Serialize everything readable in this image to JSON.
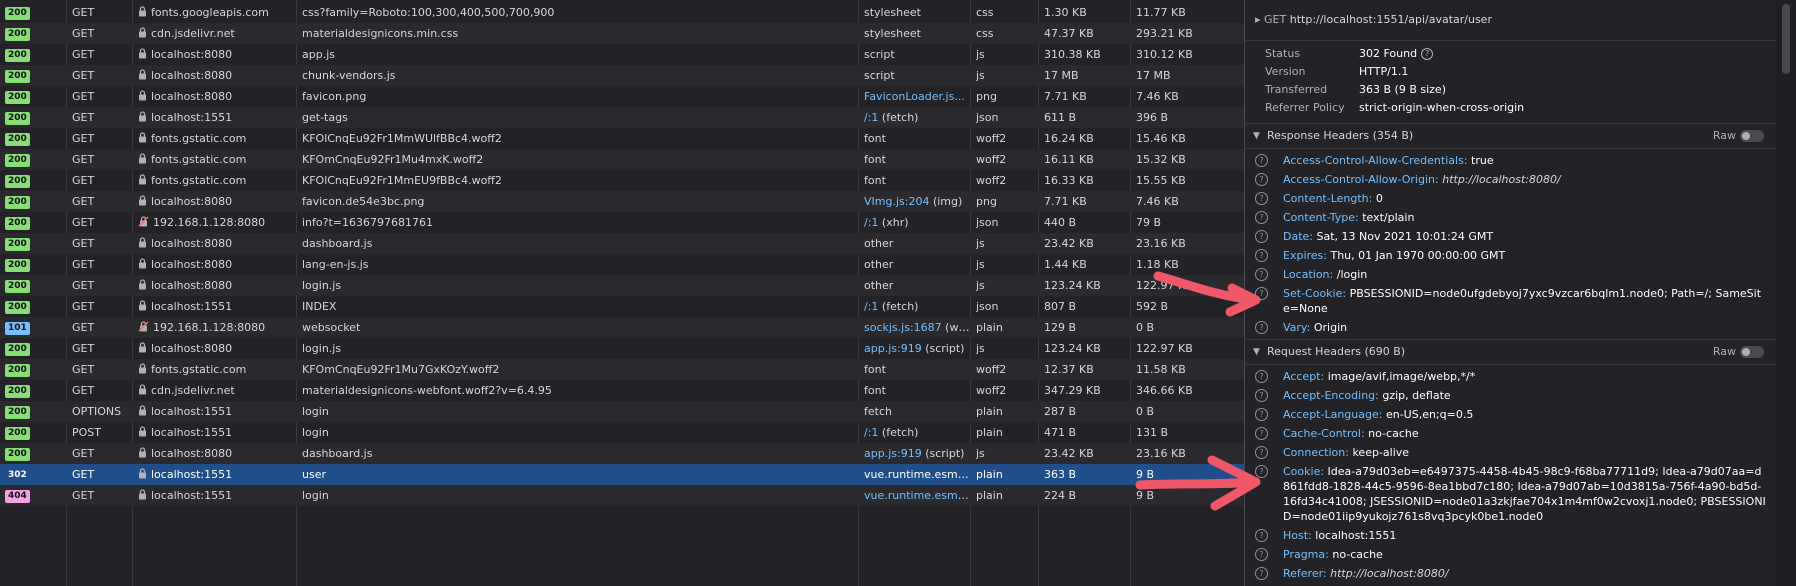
{
  "requests": [
    {
      "status": "200",
      "method": "GET",
      "secure": "lock",
      "domain": "fonts.googleapis.com",
      "file": "css?family=Roboto:100,300,400,500,700,900",
      "initiator": "stylesheet",
      "initiator_extra": "",
      "type": "css",
      "transferred": "1.30 KB",
      "size": "11.77 KB"
    },
    {
      "status": "200",
      "method": "GET",
      "secure": "lock",
      "domain": "cdn.jsdelivr.net",
      "file": "materialdesignicons.min.css",
      "initiator": "stylesheet",
      "initiator_extra": "",
      "type": "css",
      "transferred": "47.37 KB",
      "size": "293.21 KB"
    },
    {
      "status": "200",
      "method": "GET",
      "secure": "lock",
      "domain": "localhost:8080",
      "file": "app.js",
      "initiator": "script",
      "initiator_extra": "",
      "type": "js",
      "transferred": "310.38 KB",
      "size": "310.12 KB"
    },
    {
      "status": "200",
      "method": "GET",
      "secure": "lock",
      "domain": "localhost:8080",
      "file": "chunk-vendors.js",
      "initiator": "script",
      "initiator_extra": "",
      "type": "js",
      "transferred": "17 MB",
      "size": "17 MB"
    },
    {
      "status": "200",
      "method": "GET",
      "secure": "lock",
      "domain": "localhost:8080",
      "file": "favicon.png",
      "initiator": "FaviconLoader.js...",
      "initiator_extra": "",
      "type": "png",
      "transferred": "7.71 KB",
      "size": "7.46 KB",
      "initiator_link": true
    },
    {
      "status": "200",
      "method": "GET",
      "secure": "lock",
      "domain": "localhost:1551",
      "file": "get-tags",
      "initiator": "/:1",
      "initiator_extra": " (fetch)",
      "type": "json",
      "transferred": "611 B",
      "size": "396 B",
      "initiator_link": true
    },
    {
      "status": "200",
      "method": "GET",
      "secure": "lock",
      "domain": "fonts.gstatic.com",
      "file": "KFOlCnqEu92Fr1MmWUlfBBc4.woff2",
      "initiator": "font",
      "initiator_extra": "",
      "type": "woff2",
      "transferred": "16.24 KB",
      "size": "15.46 KB"
    },
    {
      "status": "200",
      "method": "GET",
      "secure": "lock",
      "domain": "fonts.gstatic.com",
      "file": "KFOmCnqEu92Fr1Mu4mxK.woff2",
      "initiator": "font",
      "initiator_extra": "",
      "type": "woff2",
      "transferred": "16.11 KB",
      "size": "15.32 KB"
    },
    {
      "status": "200",
      "method": "GET",
      "secure": "lock",
      "domain": "fonts.gstatic.com",
      "file": "KFOlCnqEu92Fr1MmEU9fBBc4.woff2",
      "initiator": "font",
      "initiator_extra": "",
      "type": "woff2",
      "transferred": "16.33 KB",
      "size": "15.55 KB"
    },
    {
      "status": "200",
      "method": "GET",
      "secure": "lock",
      "domain": "localhost:8080",
      "file": "favicon.de54e3bc.png",
      "initiator": "VImg.js:204",
      "initiator_extra": " (img)",
      "type": "png",
      "transferred": "7.71 KB",
      "size": "7.46 KB",
      "initiator_link": true
    },
    {
      "status": "200",
      "method": "GET",
      "secure": "insecure",
      "domain": "192.168.1.128:8080",
      "file": "info?t=1636797681761",
      "initiator": "/:1",
      "initiator_extra": " (xhr)",
      "type": "json",
      "transferred": "440 B",
      "size": "79 B",
      "initiator_link": true
    },
    {
      "status": "200",
      "method": "GET",
      "secure": "lock",
      "domain": "localhost:8080",
      "file": "dashboard.js",
      "initiator": "other",
      "initiator_extra": "",
      "type": "js",
      "transferred": "23.42 KB",
      "size": "23.16 KB"
    },
    {
      "status": "200",
      "method": "GET",
      "secure": "lock",
      "domain": "localhost:8080",
      "file": "lang-en-js.js",
      "initiator": "other",
      "initiator_extra": "",
      "type": "js",
      "transferred": "1.44 KB",
      "size": "1.18 KB"
    },
    {
      "status": "200",
      "method": "GET",
      "secure": "lock",
      "domain": "localhost:8080",
      "file": "login.js",
      "initiator": "other",
      "initiator_extra": "",
      "type": "js",
      "transferred": "123.24 KB",
      "size": "122.97 KB"
    },
    {
      "status": "200",
      "method": "GET",
      "secure": "lock",
      "domain": "localhost:1551",
      "file": "INDEX",
      "initiator": "/:1",
      "initiator_extra": " (fetch)",
      "type": "json",
      "transferred": "807 B",
      "size": "592 B",
      "initiator_link": true
    },
    {
      "status": "101",
      "method": "GET",
      "secure": "insecure",
      "domain": "192.168.1.128:8080",
      "file": "websocket",
      "initiator": "sockjs.js:1687",
      "initiator_extra": " (we...",
      "type": "plain",
      "transferred": "129 B",
      "size": "0 B",
      "initiator_link": true
    },
    {
      "status": "200",
      "method": "GET",
      "secure": "lock",
      "domain": "localhost:8080",
      "file": "login.js",
      "initiator": "app.js:919",
      "initiator_extra": " (script)",
      "type": "js",
      "transferred": "123.24 KB",
      "size": "122.97 KB",
      "initiator_link": true
    },
    {
      "status": "200",
      "method": "GET",
      "secure": "lock",
      "domain": "fonts.gstatic.com",
      "file": "KFOmCnqEu92Fr1Mu7GxKOzY.woff2",
      "initiator": "font",
      "initiator_extra": "",
      "type": "woff2",
      "transferred": "12.37 KB",
      "size": "11.58 KB"
    },
    {
      "status": "200",
      "method": "GET",
      "secure": "lock",
      "domain": "cdn.jsdelivr.net",
      "file": "materialdesignicons-webfont.woff2?v=6.4.95",
      "initiator": "font",
      "initiator_extra": "",
      "type": "woff2",
      "transferred": "347.29 KB",
      "size": "346.66 KB"
    },
    {
      "status": "200",
      "method": "OPTIONS",
      "secure": "lock",
      "domain": "localhost:1551",
      "file": "login",
      "initiator": "fetch",
      "initiator_extra": "",
      "type": "plain",
      "transferred": "287 B",
      "size": "0 B"
    },
    {
      "status": "200",
      "method": "POST",
      "secure": "lock",
      "domain": "localhost:1551",
      "file": "login",
      "initiator": "/:1",
      "initiator_extra": " (fetch)",
      "type": "plain",
      "transferred": "471 B",
      "size": "131 B",
      "initiator_link": true
    },
    {
      "status": "200",
      "method": "GET",
      "secure": "lock",
      "domain": "localhost:8080",
      "file": "dashboard.js",
      "initiator": "app.js:919",
      "initiator_extra": " (script)",
      "type": "js",
      "transferred": "23.42 KB",
      "size": "23.16 KB",
      "initiator_link": true
    },
    {
      "status": "302",
      "method": "GET",
      "secure": "lock",
      "domain": "localhost:1551",
      "file": "user",
      "initiator": "vue.runtime.esm.j...",
      "initiator_extra": "",
      "type": "plain",
      "transferred": "363 B",
      "size": "9 B",
      "initiator_link": true,
      "selected": true
    },
    {
      "status": "404",
      "method": "GET",
      "secure": "lock",
      "domain": "localhost:1551",
      "file": "login",
      "initiator": "vue.runtime.esm.j...",
      "initiator_extra": "",
      "type": "plain",
      "transferred": "224 B",
      "size": "9 B",
      "initiator_link": true
    }
  ],
  "details": {
    "method": "GET",
    "url": "http://localhost:1551/api/avatar/user",
    "summary": [
      {
        "key": "Status",
        "value": "302 Found"
      },
      {
        "key": "Version",
        "value": "HTTP/1.1"
      },
      {
        "key": "Transferred",
        "value": "363 B (9 B size)"
      },
      {
        "key": "Referrer Policy",
        "value": "strict-origin-when-cross-origin"
      }
    ],
    "response_title": "Response Headers (354 B)",
    "request_title": "Request Headers (690 B)",
    "raw_label": "Raw",
    "response_headers": [
      {
        "name": "Access-Control-Allow-Credentials:",
        "value": "true"
      },
      {
        "name": "Access-Control-Allow-Origin:",
        "value": "http://localhost:8080/",
        "italic": true
      },
      {
        "name": "Content-Length:",
        "value": "0"
      },
      {
        "name": "Content-Type:",
        "value": "text/plain"
      },
      {
        "name": "Date:",
        "value": "Sat, 13 Nov 2021 10:01:24 GMT"
      },
      {
        "name": "Expires:",
        "value": "Thu, 01 Jan 1970 00:00:00 GMT"
      },
      {
        "name": "Location:",
        "value": "/login"
      },
      {
        "name": "Set-Cookie:",
        "value": "PBSESSIONID=node0ufgdebyoj7yxc9vzcar6bqlm1.node0; Path=/; SameSite=None"
      },
      {
        "name": "Vary:",
        "value": "Origin"
      }
    ],
    "request_headers": [
      {
        "name": "Accept:",
        "value": "image/avif,image/webp,*/*"
      },
      {
        "name": "Accept-Encoding:",
        "value": "gzip, deflate"
      },
      {
        "name": "Accept-Language:",
        "value": "en-US,en;q=0.5"
      },
      {
        "name": "Cache-Control:",
        "value": "no-cache"
      },
      {
        "name": "Connection:",
        "value": "keep-alive"
      },
      {
        "name": "Cookie:",
        "value": "Idea-a79d03eb=e6497375-4458-4b45-98c9-f68ba77711d9; Idea-a79d07aa=d861fdd8-1828-44c5-9596-8ea1bbd7c180; Idea-a79d07ab=10d3815a-756f-4a90-bd5d-16fd34c41008; JSESSIONID=node01a3zkjfae704x1m4mf0w2cvoxj1.node0; PBSESSIONID=node01iip9yukojz761s8vq3pcyk0be1.node0"
      },
      {
        "name": "Host:",
        "value": "localhost:1551"
      },
      {
        "name": "Pragma:",
        "value": "no-cache"
      },
      {
        "name": "Referer:",
        "value": "http://localhost:8080/",
        "italic": true
      }
    ]
  },
  "colors": {
    "annotation_arrow": "#f0586a",
    "accent_link": "#75bfff",
    "selected_row": "#204e8a"
  }
}
